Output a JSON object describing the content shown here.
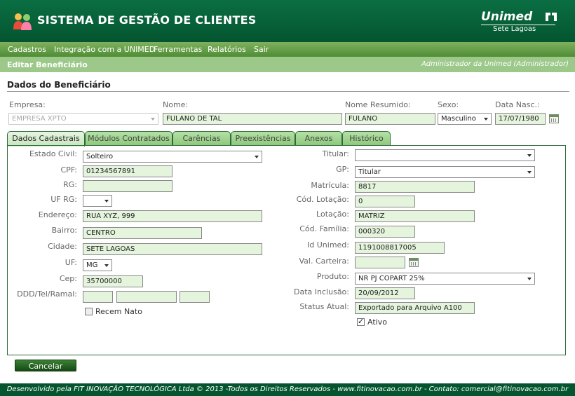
{
  "header": {
    "title": "SISTEMA DE GESTÃO DE CLIENTES",
    "brand": "Unimed",
    "brand_sub": "Sete Lagoas",
    "app_icon": "people-icon",
    "brand_icon": "unimed-logo-icon"
  },
  "menu": [
    "Cadastros",
    "Integração com a UNIMED",
    "Ferramentas",
    "Relatórios",
    "Sair"
  ],
  "subbar": {
    "page": "Editar Beneficiário",
    "user": "Administrador da Unimed (Administrador)"
  },
  "section": {
    "title": "Dados do Beneficiário"
  },
  "top_fields": {
    "empresa": {
      "label": "Empresa:",
      "value": "EMPRESA XPTO"
    },
    "nome": {
      "label": "Nome:",
      "value": "FULANO DE TAL"
    },
    "nome_resumido": {
      "label": "Nome Resumido:",
      "value": "FULANO"
    },
    "sexo": {
      "label": "Sexo:",
      "value": "Masculino"
    },
    "data_nasc": {
      "label": "Data Nasc.:",
      "value": "17/07/1980"
    }
  },
  "tabs": [
    "Dados Cadastrais",
    "Módulos Contratados",
    "Carências",
    "Preexistências",
    "Anexos",
    "Histórico"
  ],
  "left": {
    "estado_civil": {
      "label": "Estado Civil:",
      "value": "Solteiro"
    },
    "cpf": {
      "label": "CPF:",
      "value": "01234567891"
    },
    "rg": {
      "label": "RG:",
      "value": ""
    },
    "uf_rg": {
      "label": "UF RG:",
      "value": ""
    },
    "endereco": {
      "label": "Endereço:",
      "value": "RUA XYZ, 999"
    },
    "bairro": {
      "label": "Bairro:",
      "value": "CENTRO"
    },
    "cidade": {
      "label": "Cidade:",
      "value": "SETE LAGOAS"
    },
    "uf": {
      "label": "UF:",
      "value": "MG"
    },
    "cep": {
      "label": "Cep:",
      "value": "35700000"
    },
    "telefone": {
      "label": "DDD/Tel/Ramal:",
      "ddd": "",
      "tel": "",
      "ramal": ""
    },
    "recem_nato": {
      "label": "Recem Nato",
      "checked": false
    }
  },
  "right": {
    "titular": {
      "label": "Titular:",
      "value": ""
    },
    "gp": {
      "label": "GP:",
      "value": "Titular"
    },
    "matricula": {
      "label": "Matrícula:",
      "value": "8817"
    },
    "cod_lotacao": {
      "label": "Cód. Lotação:",
      "value": "0"
    },
    "lotacao": {
      "label": "Lotação:",
      "value": "MATRIZ"
    },
    "cod_familia": {
      "label": "Cód. Família:",
      "value": "000320"
    },
    "id_unimed": {
      "label": "Id Unimed:",
      "value": "1191008817005"
    },
    "val_carteira": {
      "label": "Val. Carteira:",
      "value": ""
    },
    "produto": {
      "label": "Produto:",
      "value": "NR PJ COPART 25%"
    },
    "data_inclusao": {
      "label": "Data Inclusão:",
      "value": "20/09/2012"
    },
    "status_atual": {
      "label": "Status Atual:",
      "value": "Exportado para Arquivo A100"
    },
    "ativo": {
      "label": "Ativo",
      "checked": true
    }
  },
  "actions": {
    "cancel": "Cancelar"
  },
  "footer": {
    "text": "Desenvolvido pela FIT INOVAÇÃO TECNOLÓGICA Ltda © 2013 -Todos os Direitos Reservados - www.fitinovacao.com.br - Contato: comercial@fitinovacao.com.br"
  },
  "colors": {
    "header": "#04552f",
    "menubar": "#5e9a42",
    "subbar": "#9cc88a",
    "field": "#e5f4dd",
    "tab": "#9fd18e",
    "button": "#2a6a26"
  }
}
